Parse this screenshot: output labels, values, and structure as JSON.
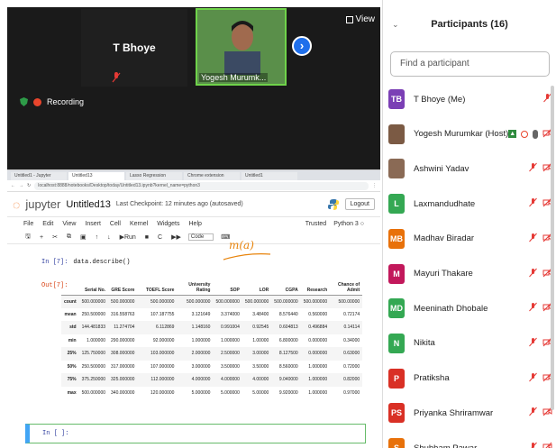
{
  "video": {
    "tiles": [
      {
        "name": "T Bhoye"
      },
      {
        "name": "Yogesh Murumk..."
      }
    ],
    "view_label": "View",
    "recording_label": "Recording"
  },
  "browser": {
    "tabs": [
      "Untitled1 - Jupyter",
      "Untitled13",
      "Lasso Regression",
      "Chrome extension",
      "Untitled1"
    ],
    "url": "localhost:8888/notebooks/Desktop/today/Untitled13.ipynb?kernel_name=python3"
  },
  "jupyter": {
    "brand": "jupyter",
    "notebook_name": "Untitled13",
    "checkpoint": "Last Checkpoint: 12 minutes ago  (autosaved)",
    "logout": "Logout",
    "menu": [
      "File",
      "Edit",
      "View",
      "Insert",
      "Cell",
      "Kernel",
      "Widgets",
      "Help"
    ],
    "trusted": "Trusted",
    "kernel": "Python 3 ○",
    "toolbar": {
      "run": "Run",
      "cell_type": "Code"
    },
    "annotation": "m(a)",
    "in_prompt": "In [7]:",
    "code": "data.describe()",
    "out_prompt": "Out[7]:",
    "empty_prompt": "In [ ]:",
    "table": {
      "columns": [
        "",
        "Serial No.",
        "GRE Score",
        "TOEFL Score",
        "University Rating",
        "SOP",
        "LOR",
        "CGPA",
        "Research",
        "Chance of Admit"
      ],
      "rows": [
        [
          "count",
          "500.000000",
          "500.000000",
          "500.000000",
          "500.000000",
          "500.000000",
          "500.000000",
          "500.000000",
          "500.000000",
          "500.00000"
        ],
        [
          "mean",
          "250.500000",
          "316.558763",
          "107.187755",
          "3.121649",
          "3.374000",
          "3.48400",
          "8.576440",
          "0.560000",
          "0.72174"
        ],
        [
          "std",
          "144.481833",
          "11.274704",
          "6.112869",
          "1.148160",
          "0.991004",
          "0.92545",
          "0.604813",
          "0.496884",
          "0.14114"
        ],
        [
          "min",
          "1.000000",
          "290.000000",
          "92.000000",
          "1.000000",
          "1.000000",
          "1.00000",
          "6.800000",
          "0.000000",
          "0.34000"
        ],
        [
          "25%",
          "125.750000",
          "308.000000",
          "103.000000",
          "2.000000",
          "2.500000",
          "3.00000",
          "8.127500",
          "0.000000",
          "0.63000"
        ],
        [
          "50%",
          "250.500000",
          "317.000000",
          "107.000000",
          "3.000000",
          "3.500000",
          "3.50000",
          "8.560000",
          "1.000000",
          "0.72000"
        ],
        [
          "75%",
          "375.250000",
          "325.000000",
          "112.000000",
          "4.000000",
          "4.000000",
          "4.00000",
          "9.040000",
          "1.000000",
          "0.82000"
        ],
        [
          "max",
          "500.000000",
          "340.000000",
          "120.000000",
          "5.000000",
          "5.000000",
          "5.00000",
          "9.920000",
          "1.000000",
          "0.97000"
        ]
      ]
    }
  },
  "panel": {
    "title": "Participants (16)",
    "search_placeholder": "Find a participant",
    "participants": [
      {
        "initials": "TB",
        "name": "T Bhoye (Me)",
        "color": "#7b3fb5"
      },
      {
        "initials": "",
        "name": "Yogesh Murumkar (Host)",
        "color": "#7b5a44"
      },
      {
        "initials": "",
        "name": "Ashwini Yadav",
        "color": "#8a6a55"
      },
      {
        "initials": "L",
        "name": "Laxmandudhate",
        "color": "#34a853"
      },
      {
        "initials": "MB",
        "name": "Madhav Biradar",
        "color": "#e8710a"
      },
      {
        "initials": "M",
        "name": "Mayuri Thakare",
        "color": "#c2185b"
      },
      {
        "initials": "MD",
        "name": "Meeninath Dhobale",
        "color": "#34a853"
      },
      {
        "initials": "N",
        "name": "Nikita",
        "color": "#34a853"
      },
      {
        "initials": "P",
        "name": "Pratiksha",
        "color": "#d93025"
      },
      {
        "initials": "PS",
        "name": "Priyanka Shriramwar",
        "color": "#d93025"
      },
      {
        "initials": "S",
        "name": "Shubham Pawar",
        "color": "#e8710a"
      }
    ]
  }
}
